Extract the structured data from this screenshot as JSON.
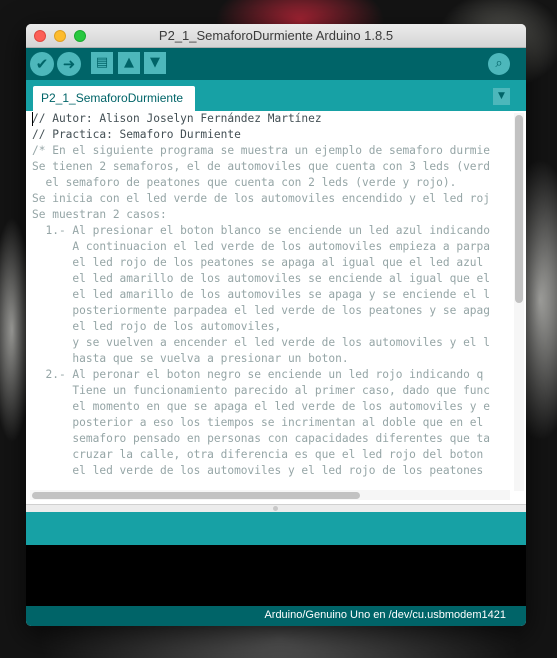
{
  "window": {
    "title": "P2_1_SemaforoDurmiente Arduino 1.8.5"
  },
  "toolbar": {
    "verify_icon": "check-icon",
    "upload_icon": "arrow-right-icon",
    "new_icon": "file-icon",
    "open_icon": "arrow-up-icon",
    "save_icon": "arrow-down-icon",
    "serial_monitor_icon": "magnifier-icon"
  },
  "tabs": [
    {
      "label": "P2_1_SemaforoDurmiente"
    }
  ],
  "editor": {
    "lines": [
      "// Autor: Alison Joselyn Fernández Martínez",
      "// Practica: Semaforo Durmiente",
      "/* En el siguiente programa se muestra un ejemplo de semaforo durmie",
      "Se tienen 2 semaforos, el de automoviles que cuenta con 3 leds (verd",
      "  el semaforo de peatones que cuenta con 2 leds (verde y rojo).",
      "Se inicia con el led verde de los automoviles encendido y el led roj",
      "Se muestran 2 casos:",
      "  1.- Al presionar el boton blanco se enciende un led azul indicando",
      "      A continuacion el led verde de los automoviles empieza a parpa",
      "      el led rojo de los peatones se apaga al igual que el led azul ",
      "      el led amarillo de los automoviles se enciende al igual que el",
      "      el led amarillo de los automoviles se apaga y se enciende el l",
      "      posteriormente parpadea el led verde de los peatones y se apag",
      "      el led rojo de los automoviles,",
      "      y se vuelven a encender el led verde de los automoviles y el l",
      "      hasta que se vuelva a presionar un boton.",
      "  2.- Al peronar el boton negro se enciende un led rojo indicando q",
      "      Tiene un funcionamiento parecido al primer caso, dado que func",
      "      el momento en que se apaga el led verde de los automoviles y e",
      "      posterior a eso los tiempos se incrimentan al doble que en el ",
      "      semaforo pensado en personas con capacidades diferentes que ta",
      "      cruzar la calle, otra diferencia es que el led rojo del boton ",
      "      el led verde de los automoviles y el led rojo de los peatones "
    ]
  },
  "status": {
    "board": "Arduino/Genuino Uno en /dev/cu.usbmodem1421"
  }
}
